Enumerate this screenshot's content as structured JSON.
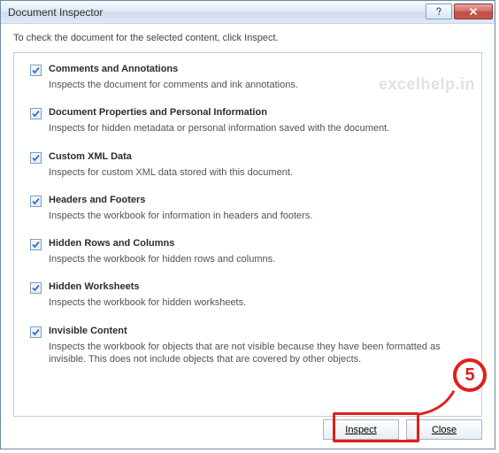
{
  "titlebar": {
    "title": "Document Inspector"
  },
  "intro": "To check the document for the selected content, click Inspect.",
  "items": [
    {
      "label": "Comments and Annotations",
      "desc": "Inspects the document for comments and ink annotations."
    },
    {
      "label": "Document Properties and Personal Information",
      "desc": "Inspects for hidden metadata or personal information saved with the document."
    },
    {
      "label": "Custom XML Data",
      "desc": "Inspects for custom XML data stored with this document."
    },
    {
      "label": "Headers and Footers",
      "desc": "Inspects the workbook for information in headers and footers."
    },
    {
      "label": "Hidden Rows and Columns",
      "desc": "Inspects the workbook for hidden rows and columns."
    },
    {
      "label": "Hidden Worksheets",
      "desc": "Inspects the workbook for hidden worksheets."
    },
    {
      "label": "Invisible Content",
      "desc": "Inspects the workbook for objects that are not visible because they have been formatted as invisible. This does not include objects that are covered by other objects."
    }
  ],
  "buttons": {
    "inspect": "Inspect",
    "close": "Close"
  },
  "callout": {
    "number": "5"
  },
  "watermark": "excelhelp.in"
}
